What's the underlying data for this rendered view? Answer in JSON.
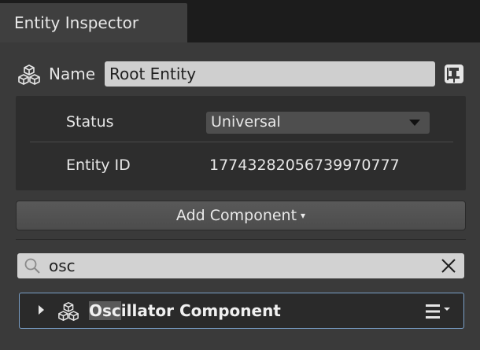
{
  "tab": {
    "title": "Entity Inspector"
  },
  "entity": {
    "name_label": "Name",
    "name_value": "Root Entity"
  },
  "properties": {
    "status_label": "Status",
    "status_value": "Universal",
    "id_label": "Entity ID",
    "id_value": "17743282056739970777"
  },
  "add_component": {
    "label": "Add Component",
    "arrow": "▾"
  },
  "search": {
    "value": "osc"
  },
  "components": [
    {
      "match": "Osc",
      "rest": "illator Component"
    }
  ],
  "icons": {
    "entity": "cubes-icon",
    "pin": "pin-icon",
    "search": "search-icon",
    "clear": "close-icon",
    "component": "cubes-icon",
    "menu": "hamburger-menu-icon"
  }
}
